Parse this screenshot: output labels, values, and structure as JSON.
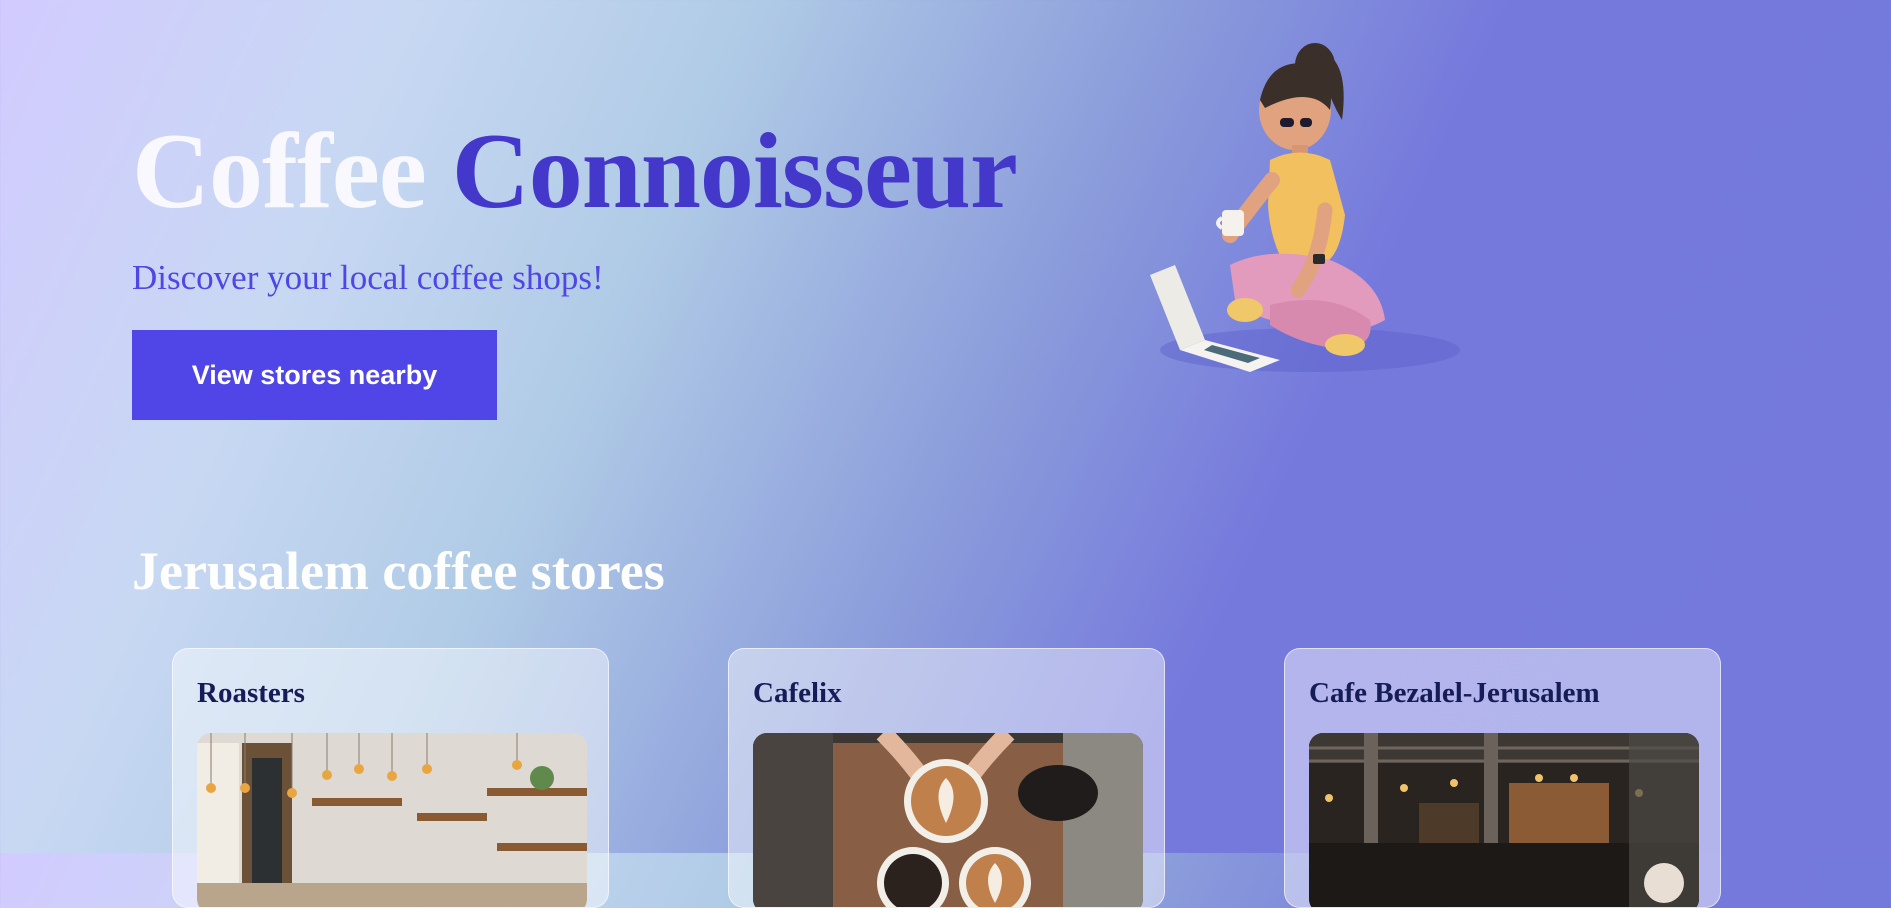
{
  "hero": {
    "title_part1": "Coffee",
    "title_part2": "Connoisseur",
    "subtitle": "Discover your local coffee shops!",
    "cta_label": "View stores nearby",
    "illustration": "woman-with-laptop-and-coffee"
  },
  "stores_section": {
    "title": "Jerusalem coffee stores",
    "stores": [
      {
        "name": "Roasters",
        "image": "coffee-shop-interior-with-hanging-bulbs"
      },
      {
        "name": "Cafelix",
        "image": "hands-holding-latte-art-cups"
      },
      {
        "name": "Cafe Bezalel-Jerusalem",
        "image": "industrial-cafe-interior"
      }
    ]
  },
  "colors": {
    "accent": "#4338ca",
    "button": "#5045e6",
    "card_title": "#161c57",
    "title_light": "#f8f8fe"
  }
}
